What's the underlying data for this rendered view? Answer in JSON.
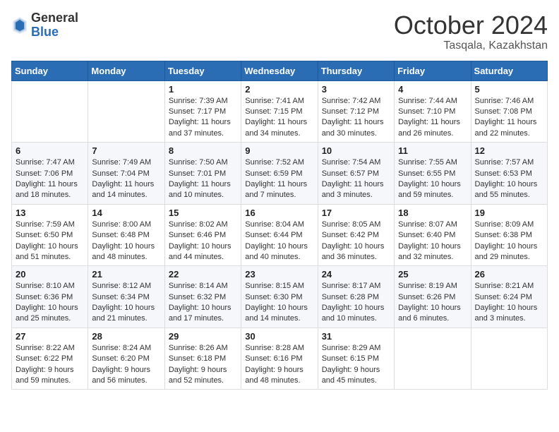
{
  "header": {
    "logo_general": "General",
    "logo_blue": "Blue",
    "month_title": "October 2024",
    "location": "Tasqala, Kazakhstan"
  },
  "weekdays": [
    "Sunday",
    "Monday",
    "Tuesday",
    "Wednesday",
    "Thursday",
    "Friday",
    "Saturday"
  ],
  "weeks": [
    [
      {
        "day": "",
        "sunrise": "",
        "sunset": "",
        "daylight": ""
      },
      {
        "day": "",
        "sunrise": "",
        "sunset": "",
        "daylight": ""
      },
      {
        "day": "1",
        "sunrise": "Sunrise: 7:39 AM",
        "sunset": "Sunset: 7:17 PM",
        "daylight": "Daylight: 11 hours and 37 minutes."
      },
      {
        "day": "2",
        "sunrise": "Sunrise: 7:41 AM",
        "sunset": "Sunset: 7:15 PM",
        "daylight": "Daylight: 11 hours and 34 minutes."
      },
      {
        "day": "3",
        "sunrise": "Sunrise: 7:42 AM",
        "sunset": "Sunset: 7:12 PM",
        "daylight": "Daylight: 11 hours and 30 minutes."
      },
      {
        "day": "4",
        "sunrise": "Sunrise: 7:44 AM",
        "sunset": "Sunset: 7:10 PM",
        "daylight": "Daylight: 11 hours and 26 minutes."
      },
      {
        "day": "5",
        "sunrise": "Sunrise: 7:46 AM",
        "sunset": "Sunset: 7:08 PM",
        "daylight": "Daylight: 11 hours and 22 minutes."
      }
    ],
    [
      {
        "day": "6",
        "sunrise": "Sunrise: 7:47 AM",
        "sunset": "Sunset: 7:06 PM",
        "daylight": "Daylight: 11 hours and 18 minutes."
      },
      {
        "day": "7",
        "sunrise": "Sunrise: 7:49 AM",
        "sunset": "Sunset: 7:04 PM",
        "daylight": "Daylight: 11 hours and 14 minutes."
      },
      {
        "day": "8",
        "sunrise": "Sunrise: 7:50 AM",
        "sunset": "Sunset: 7:01 PM",
        "daylight": "Daylight: 11 hours and 10 minutes."
      },
      {
        "day": "9",
        "sunrise": "Sunrise: 7:52 AM",
        "sunset": "Sunset: 6:59 PM",
        "daylight": "Daylight: 11 hours and 7 minutes."
      },
      {
        "day": "10",
        "sunrise": "Sunrise: 7:54 AM",
        "sunset": "Sunset: 6:57 PM",
        "daylight": "Daylight: 11 hours and 3 minutes."
      },
      {
        "day": "11",
        "sunrise": "Sunrise: 7:55 AM",
        "sunset": "Sunset: 6:55 PM",
        "daylight": "Daylight: 10 hours and 59 minutes."
      },
      {
        "day": "12",
        "sunrise": "Sunrise: 7:57 AM",
        "sunset": "Sunset: 6:53 PM",
        "daylight": "Daylight: 10 hours and 55 minutes."
      }
    ],
    [
      {
        "day": "13",
        "sunrise": "Sunrise: 7:59 AM",
        "sunset": "Sunset: 6:50 PM",
        "daylight": "Daylight: 10 hours and 51 minutes."
      },
      {
        "day": "14",
        "sunrise": "Sunrise: 8:00 AM",
        "sunset": "Sunset: 6:48 PM",
        "daylight": "Daylight: 10 hours and 48 minutes."
      },
      {
        "day": "15",
        "sunrise": "Sunrise: 8:02 AM",
        "sunset": "Sunset: 6:46 PM",
        "daylight": "Daylight: 10 hours and 44 minutes."
      },
      {
        "day": "16",
        "sunrise": "Sunrise: 8:04 AM",
        "sunset": "Sunset: 6:44 PM",
        "daylight": "Daylight: 10 hours and 40 minutes."
      },
      {
        "day": "17",
        "sunrise": "Sunrise: 8:05 AM",
        "sunset": "Sunset: 6:42 PM",
        "daylight": "Daylight: 10 hours and 36 minutes."
      },
      {
        "day": "18",
        "sunrise": "Sunrise: 8:07 AM",
        "sunset": "Sunset: 6:40 PM",
        "daylight": "Daylight: 10 hours and 32 minutes."
      },
      {
        "day": "19",
        "sunrise": "Sunrise: 8:09 AM",
        "sunset": "Sunset: 6:38 PM",
        "daylight": "Daylight: 10 hours and 29 minutes."
      }
    ],
    [
      {
        "day": "20",
        "sunrise": "Sunrise: 8:10 AM",
        "sunset": "Sunset: 6:36 PM",
        "daylight": "Daylight: 10 hours and 25 minutes."
      },
      {
        "day": "21",
        "sunrise": "Sunrise: 8:12 AM",
        "sunset": "Sunset: 6:34 PM",
        "daylight": "Daylight: 10 hours and 21 minutes."
      },
      {
        "day": "22",
        "sunrise": "Sunrise: 8:14 AM",
        "sunset": "Sunset: 6:32 PM",
        "daylight": "Daylight: 10 hours and 17 minutes."
      },
      {
        "day": "23",
        "sunrise": "Sunrise: 8:15 AM",
        "sunset": "Sunset: 6:30 PM",
        "daylight": "Daylight: 10 hours and 14 minutes."
      },
      {
        "day": "24",
        "sunrise": "Sunrise: 8:17 AM",
        "sunset": "Sunset: 6:28 PM",
        "daylight": "Daylight: 10 hours and 10 minutes."
      },
      {
        "day": "25",
        "sunrise": "Sunrise: 8:19 AM",
        "sunset": "Sunset: 6:26 PM",
        "daylight": "Daylight: 10 hours and 6 minutes."
      },
      {
        "day": "26",
        "sunrise": "Sunrise: 8:21 AM",
        "sunset": "Sunset: 6:24 PM",
        "daylight": "Daylight: 10 hours and 3 minutes."
      }
    ],
    [
      {
        "day": "27",
        "sunrise": "Sunrise: 8:22 AM",
        "sunset": "Sunset: 6:22 PM",
        "daylight": "Daylight: 9 hours and 59 minutes."
      },
      {
        "day": "28",
        "sunrise": "Sunrise: 8:24 AM",
        "sunset": "Sunset: 6:20 PM",
        "daylight": "Daylight: 9 hours and 56 minutes."
      },
      {
        "day": "29",
        "sunrise": "Sunrise: 8:26 AM",
        "sunset": "Sunset: 6:18 PM",
        "daylight": "Daylight: 9 hours and 52 minutes."
      },
      {
        "day": "30",
        "sunrise": "Sunrise: 8:28 AM",
        "sunset": "Sunset: 6:16 PM",
        "daylight": "Daylight: 9 hours and 48 minutes."
      },
      {
        "day": "31",
        "sunrise": "Sunrise: 8:29 AM",
        "sunset": "Sunset: 6:15 PM",
        "daylight": "Daylight: 9 hours and 45 minutes."
      },
      {
        "day": "",
        "sunrise": "",
        "sunset": "",
        "daylight": ""
      },
      {
        "day": "",
        "sunrise": "",
        "sunset": "",
        "daylight": ""
      }
    ]
  ]
}
